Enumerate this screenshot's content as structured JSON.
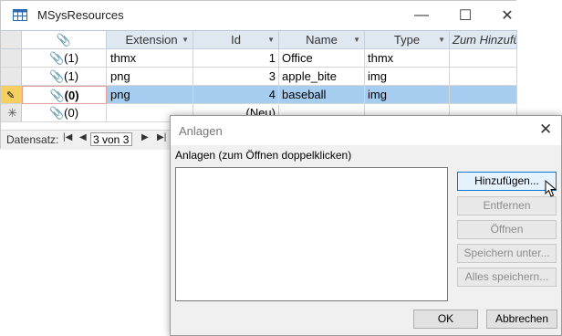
{
  "window": {
    "title": "MSysResources",
    "minimize_glyph": "—",
    "maximize_glyph": "☐",
    "close_glyph": "✕"
  },
  "table": {
    "columns": [
      "Extension",
      "Id",
      "Name",
      "Type",
      "Zum Hinzufüg"
    ],
    "rows": [
      {
        "attachments": "(1)",
        "extension": "thmx",
        "id": "1",
        "name": "Office",
        "type": "thmx"
      },
      {
        "attachments": "(1)",
        "extension": "png",
        "id": "3",
        "name": "apple_bite",
        "type": "img"
      },
      {
        "attachments": "(0)",
        "extension": "png",
        "id": "4",
        "name": "baseball",
        "type": "img"
      }
    ],
    "new_row": {
      "attachments": "(0)",
      "id": "(Neu)"
    }
  },
  "nav": {
    "label": "Datensatz:",
    "position": "3 von 3",
    "first": "|◀",
    "prev": "◀",
    "next": "▶",
    "last": "▶|"
  },
  "dialog": {
    "title": "Anlagen",
    "label": "Anlagen (zum Öffnen doppelklicken)",
    "buttons": {
      "add": "Hinzufügen...",
      "remove": "Entfernen",
      "open": "Öffnen",
      "save": "Speichern unter...",
      "save_all": "Alles speichern..."
    },
    "ok": "OK",
    "cancel": "Abbrechen"
  },
  "colors": {
    "selected_row": "#a6cdf0",
    "header_bg": "#dfe7f0"
  }
}
